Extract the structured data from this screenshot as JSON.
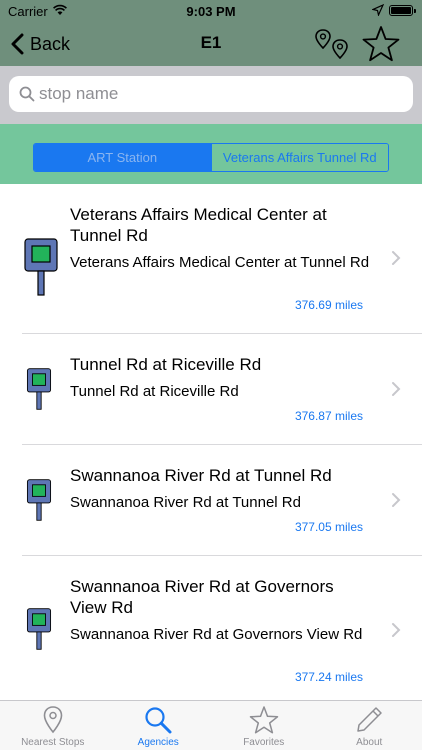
{
  "status_bar": {
    "carrier": "Carrier",
    "time": "9:03 PM"
  },
  "nav": {
    "back_label": "Back",
    "title": "E1"
  },
  "search": {
    "placeholder": "stop name",
    "value": ""
  },
  "segments": [
    {
      "label": "ART Station",
      "selected": true
    },
    {
      "label": "Veterans Affairs Tunnel Rd",
      "selected": false
    }
  ],
  "stops": [
    {
      "title": "Veterans Affairs Medical Center at Tunnel Rd",
      "subtitle": "Veterans Affairs Medical Center at Tunnel Rd",
      "distance": "376.69 miles"
    },
    {
      "title": "Tunnel Rd at Riceville Rd",
      "subtitle": "Tunnel Rd at Riceville Rd",
      "distance": "376.87 miles"
    },
    {
      "title": "Swannanoa River Rd at Tunnel Rd",
      "subtitle": "Swannanoa River Rd at Tunnel Rd",
      "distance": "377.05 miles"
    },
    {
      "title": "Swannanoa River Rd at Governors View Rd",
      "subtitle": "Swannanoa River Rd at Governors View Rd",
      "distance": "377.24 miles"
    }
  ],
  "tabs": [
    {
      "label": "Nearest Stops",
      "icon": "location-pin-icon",
      "selected": false
    },
    {
      "label": "Agencies",
      "icon": "magnifier-icon",
      "selected": true
    },
    {
      "label": "Favorites",
      "icon": "star-icon",
      "selected": false
    },
    {
      "label": "About",
      "icon": "pencil-icon",
      "selected": false
    }
  ],
  "colors": {
    "nav_bar": "#6f8f7c",
    "segment_bar": "#74c69c",
    "accent_blue": "#1a78f0",
    "stop_sign_green": "#22b35a"
  }
}
